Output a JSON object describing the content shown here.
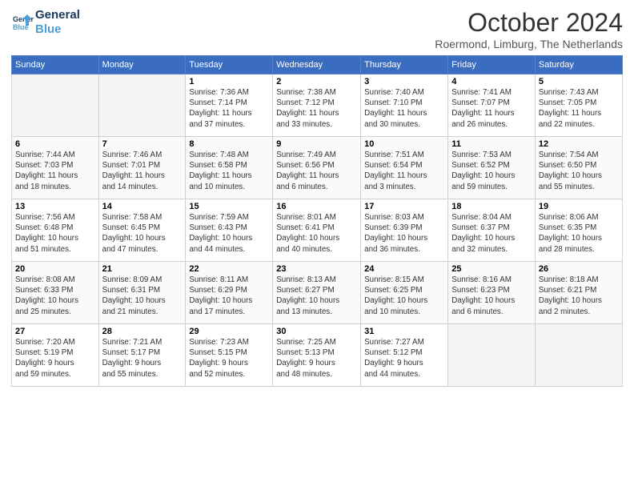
{
  "header": {
    "logo_line1": "General",
    "logo_line2": "Blue",
    "month_title": "October 2024",
    "location": "Roermond, Limburg, The Netherlands"
  },
  "weekdays": [
    "Sunday",
    "Monday",
    "Tuesday",
    "Wednesday",
    "Thursday",
    "Friday",
    "Saturday"
  ],
  "weeks": [
    [
      {
        "day": "",
        "info": ""
      },
      {
        "day": "",
        "info": ""
      },
      {
        "day": "1",
        "info": "Sunrise: 7:36 AM\nSunset: 7:14 PM\nDaylight: 11 hours\nand 37 minutes."
      },
      {
        "day": "2",
        "info": "Sunrise: 7:38 AM\nSunset: 7:12 PM\nDaylight: 11 hours\nand 33 minutes."
      },
      {
        "day": "3",
        "info": "Sunrise: 7:40 AM\nSunset: 7:10 PM\nDaylight: 11 hours\nand 30 minutes."
      },
      {
        "day": "4",
        "info": "Sunrise: 7:41 AM\nSunset: 7:07 PM\nDaylight: 11 hours\nand 26 minutes."
      },
      {
        "day": "5",
        "info": "Sunrise: 7:43 AM\nSunset: 7:05 PM\nDaylight: 11 hours\nand 22 minutes."
      }
    ],
    [
      {
        "day": "6",
        "info": "Sunrise: 7:44 AM\nSunset: 7:03 PM\nDaylight: 11 hours\nand 18 minutes."
      },
      {
        "day": "7",
        "info": "Sunrise: 7:46 AM\nSunset: 7:01 PM\nDaylight: 11 hours\nand 14 minutes."
      },
      {
        "day": "8",
        "info": "Sunrise: 7:48 AM\nSunset: 6:58 PM\nDaylight: 11 hours\nand 10 minutes."
      },
      {
        "day": "9",
        "info": "Sunrise: 7:49 AM\nSunset: 6:56 PM\nDaylight: 11 hours\nand 6 minutes."
      },
      {
        "day": "10",
        "info": "Sunrise: 7:51 AM\nSunset: 6:54 PM\nDaylight: 11 hours\nand 3 minutes."
      },
      {
        "day": "11",
        "info": "Sunrise: 7:53 AM\nSunset: 6:52 PM\nDaylight: 10 hours\nand 59 minutes."
      },
      {
        "day": "12",
        "info": "Sunrise: 7:54 AM\nSunset: 6:50 PM\nDaylight: 10 hours\nand 55 minutes."
      }
    ],
    [
      {
        "day": "13",
        "info": "Sunrise: 7:56 AM\nSunset: 6:48 PM\nDaylight: 10 hours\nand 51 minutes."
      },
      {
        "day": "14",
        "info": "Sunrise: 7:58 AM\nSunset: 6:45 PM\nDaylight: 10 hours\nand 47 minutes."
      },
      {
        "day": "15",
        "info": "Sunrise: 7:59 AM\nSunset: 6:43 PM\nDaylight: 10 hours\nand 44 minutes."
      },
      {
        "day": "16",
        "info": "Sunrise: 8:01 AM\nSunset: 6:41 PM\nDaylight: 10 hours\nand 40 minutes."
      },
      {
        "day": "17",
        "info": "Sunrise: 8:03 AM\nSunset: 6:39 PM\nDaylight: 10 hours\nand 36 minutes."
      },
      {
        "day": "18",
        "info": "Sunrise: 8:04 AM\nSunset: 6:37 PM\nDaylight: 10 hours\nand 32 minutes."
      },
      {
        "day": "19",
        "info": "Sunrise: 8:06 AM\nSunset: 6:35 PM\nDaylight: 10 hours\nand 28 minutes."
      }
    ],
    [
      {
        "day": "20",
        "info": "Sunrise: 8:08 AM\nSunset: 6:33 PM\nDaylight: 10 hours\nand 25 minutes."
      },
      {
        "day": "21",
        "info": "Sunrise: 8:09 AM\nSunset: 6:31 PM\nDaylight: 10 hours\nand 21 minutes."
      },
      {
        "day": "22",
        "info": "Sunrise: 8:11 AM\nSunset: 6:29 PM\nDaylight: 10 hours\nand 17 minutes."
      },
      {
        "day": "23",
        "info": "Sunrise: 8:13 AM\nSunset: 6:27 PM\nDaylight: 10 hours\nand 13 minutes."
      },
      {
        "day": "24",
        "info": "Sunrise: 8:15 AM\nSunset: 6:25 PM\nDaylight: 10 hours\nand 10 minutes."
      },
      {
        "day": "25",
        "info": "Sunrise: 8:16 AM\nSunset: 6:23 PM\nDaylight: 10 hours\nand 6 minutes."
      },
      {
        "day": "26",
        "info": "Sunrise: 8:18 AM\nSunset: 6:21 PM\nDaylight: 10 hours\nand 2 minutes."
      }
    ],
    [
      {
        "day": "27",
        "info": "Sunrise: 7:20 AM\nSunset: 5:19 PM\nDaylight: 9 hours\nand 59 minutes."
      },
      {
        "day": "28",
        "info": "Sunrise: 7:21 AM\nSunset: 5:17 PM\nDaylight: 9 hours\nand 55 minutes."
      },
      {
        "day": "29",
        "info": "Sunrise: 7:23 AM\nSunset: 5:15 PM\nDaylight: 9 hours\nand 52 minutes."
      },
      {
        "day": "30",
        "info": "Sunrise: 7:25 AM\nSunset: 5:13 PM\nDaylight: 9 hours\nand 48 minutes."
      },
      {
        "day": "31",
        "info": "Sunrise: 7:27 AM\nSunset: 5:12 PM\nDaylight: 9 hours\nand 44 minutes."
      },
      {
        "day": "",
        "info": ""
      },
      {
        "day": "",
        "info": ""
      }
    ]
  ]
}
